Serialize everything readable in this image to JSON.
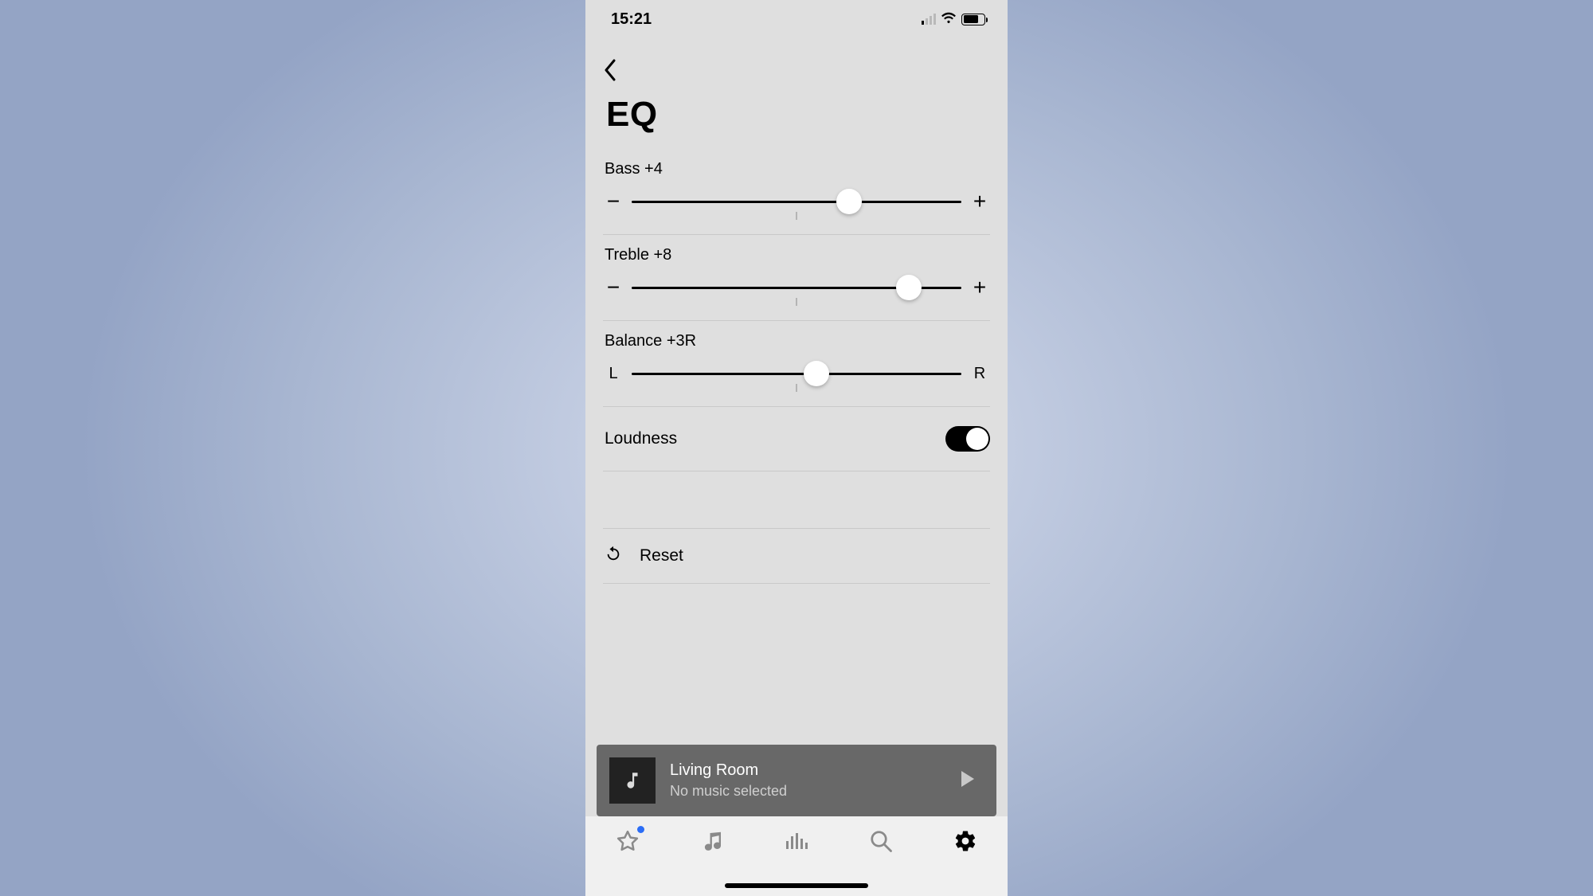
{
  "status": {
    "time": "15:21"
  },
  "page": {
    "title": "EQ"
  },
  "eq": {
    "bass": {
      "label": "Bass +4",
      "percent": 66,
      "left": "−",
      "right": "+"
    },
    "treble": {
      "label": "Treble +8",
      "percent": 84,
      "left": "−",
      "right": "+"
    },
    "balance": {
      "label": "Balance +3R",
      "percent": 56,
      "left": "L",
      "right": "R"
    }
  },
  "loudness": {
    "label": "Loudness",
    "on": true
  },
  "reset": {
    "label": "Reset"
  },
  "now_playing": {
    "room": "Living Room",
    "subtitle": "No music selected"
  }
}
